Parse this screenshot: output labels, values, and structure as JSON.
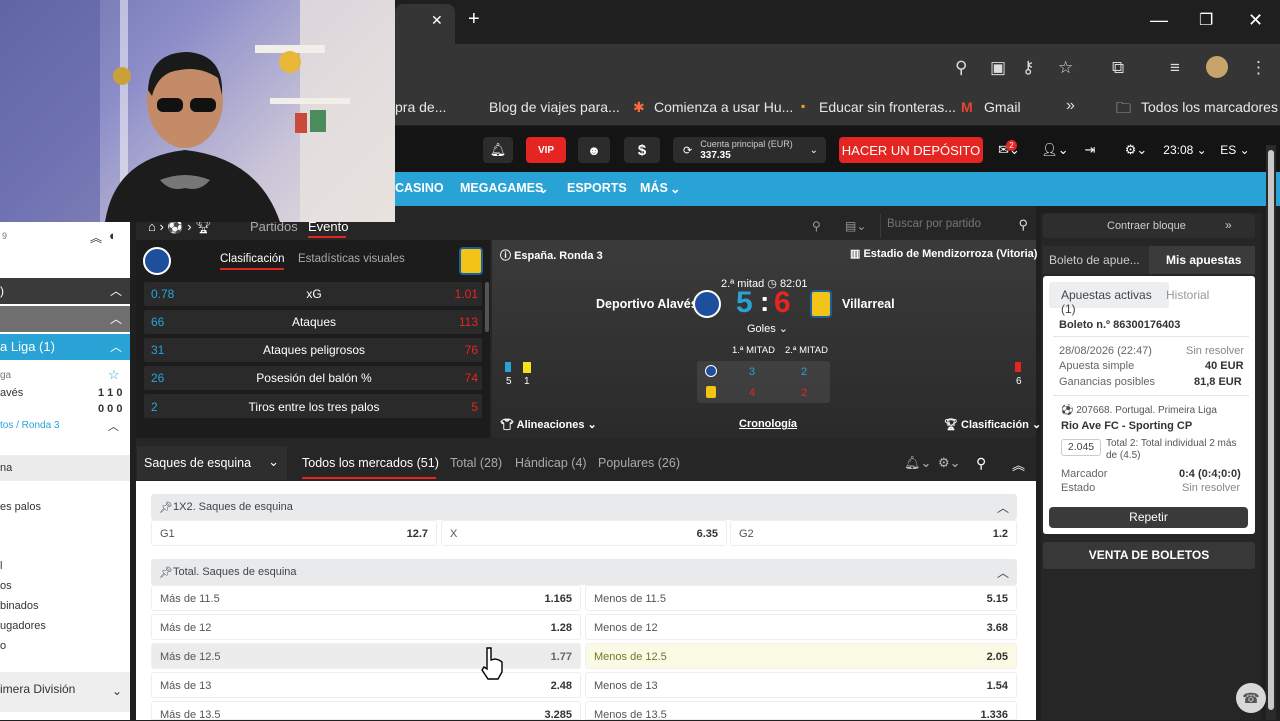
{
  "browser": {
    "bookmarks": [
      "pra de...",
      "Blog de viajes para...",
      "Comienza a usar Hu...",
      "Educar sin fronteras...",
      "Gmail",
      "Todos los marcadores"
    ],
    "tab_close": "✕",
    "tab_add": "+"
  },
  "header": {
    "vip": "VIP",
    "account_label": "Cuenta principal (EUR)",
    "balance": "337.35",
    "deposit_button": "HACER UN DEPÓSITO",
    "time": "23:08",
    "language": "ES",
    "mail_badge": "2"
  },
  "nav": [
    "CASINO",
    "MEGAGAMES",
    "ESPORTS",
    "MÁS"
  ],
  "breadcrumb": {
    "partidos": "Partidos",
    "evento": "Evento",
    "search_placeholder": "Buscar por partido"
  },
  "stats": {
    "tab_clasificacion": "Clasificación",
    "tab_visual": "Estadísticas visuales",
    "rows": [
      {
        "home": "0.78",
        "label": "xG",
        "away": "1.01"
      },
      {
        "home": "66",
        "label": "Ataques",
        "away": "113"
      },
      {
        "home": "31",
        "label": "Ataques peligrosos",
        "away": "76"
      },
      {
        "home": "26",
        "label": "Posesión del balón %",
        "away": "74"
      },
      {
        "home": "2",
        "label": "Tiros entre los tres palos",
        "away": "5"
      }
    ]
  },
  "match": {
    "round": "España. Ronda 3",
    "stadium": "Estadio de Mendizorroza (Vitoria)",
    "period": "2.ª mitad",
    "clock": "82:01",
    "home": "Deportivo Alavés",
    "away": "Villarreal",
    "home_score": "5",
    "separator": ":",
    "away_score": "6",
    "goles": "Goles",
    "home_flags_left": "5",
    "home_yellow": "1",
    "away_flags": "6",
    "half1": "1.ª MITAD",
    "half2": "2.ª MITAD",
    "home_h1": "3",
    "home_h2": "2",
    "away_h1": "4",
    "away_h2": "2",
    "alineaciones": "Alineaciones",
    "cronologia": "Cronología",
    "clasificacion": "Clasificación"
  },
  "markets": {
    "selector": "Saques de esquina",
    "tabs": [
      {
        "label": "Todos los mercados (51)",
        "active": true
      },
      {
        "label": "Total (28)"
      },
      {
        "label": "Hándicap (4)"
      },
      {
        "label": "Populares (26)"
      }
    ],
    "m1x2": {
      "title": "1X2. Saques de esquina",
      "odds": [
        {
          "label": "G1",
          "value": "12.7"
        },
        {
          "label": "X",
          "value": "6.35"
        },
        {
          "label": "G2",
          "value": "1.2"
        }
      ]
    },
    "total": {
      "title": "Total. Saques de esquina",
      "rows": [
        {
          "over": "Más de 11.5",
          "over_val": "1.165",
          "under": "Menos de 11.5",
          "under_val": "5.15"
        },
        {
          "over": "Más de 12",
          "over_val": "1.28",
          "under": "Menos de 12",
          "under_val": "3.68"
        },
        {
          "over": "Más de 12.5",
          "over_val": "1.77",
          "under": "Menos de 12.5",
          "under_val": "2.05"
        },
        {
          "over": "Más de 13",
          "over_val": "2.48",
          "under": "Menos de 13",
          "under_val": "1.54"
        },
        {
          "over": "Más de 13.5",
          "over_val": "3.285",
          "under": "Menos de 13.5",
          "under_val": "1.336"
        }
      ]
    }
  },
  "leftpanel": {
    "rows": [
      "9",
      ")",
      "a Liga (1)",
      "ga",
      "avés",
      "tos / Ronda 3",
      "na",
      "es palos",
      "l",
      "os",
      "binados",
      "ugadores",
      "o",
      "imera División"
    ],
    "score1": "1 1 0",
    "score2": "0 0 0"
  },
  "betslip": {
    "collapse": "Contraer bloque",
    "tab_boleto": "Boleto de apue...",
    "tab_mis": "Mis apuestas",
    "tab_activas": "Apuestas activas (1)",
    "tab_historial": "Historial",
    "ticket": "Boleto n.º 86300176403",
    "date": "28/08/2026 (22:47)",
    "status": "Sin resolver",
    "type_label": "Apuesta simple",
    "stake": "40 EUR",
    "gains_label": "Ganancias posibles",
    "gains": "81,8 EUR",
    "event_league": "207668. Portugal. Primeira Liga",
    "event_match": "Rio Ave FC - Sporting CP",
    "odd": "2.045",
    "bet_desc": "Total 2: Total individual 2 más de (4.5)",
    "marcador_label": "Marcador",
    "marcador": "0:4 (0:4;0:0)",
    "estado_label": "Estado",
    "estado": "Sin resolver",
    "repeat": "Repetir",
    "venta": "VENTA DE BOLETOS"
  },
  "colors": {
    "accent": "#29a3d6",
    "danger": "#e52521",
    "highlight": "#fbfbe5"
  }
}
